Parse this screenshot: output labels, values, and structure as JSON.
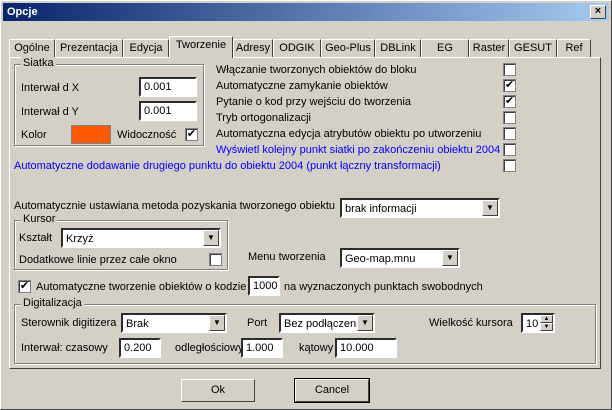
{
  "window": {
    "title": "Opcje",
    "close_glyph": "×"
  },
  "tabs": [
    "Ogólne",
    "Prezentacja",
    "Edycja",
    "Tworzenie",
    "Adresy",
    "ODGIK",
    "Geo-Plus",
    "DBLink",
    "EG",
    "Raster",
    "GESUT",
    "Ref"
  ],
  "active_tab": "Tworzenie",
  "siatka": {
    "title": "Siatka",
    "interwal_x_label": "Interwał d X",
    "interwal_x_value": "0.001",
    "interwal_y_label": "Interwał d Y",
    "interwal_y_value": "0.001",
    "kolor_label": "Kolor",
    "kolor_color": "#ff5a00",
    "widocznosc_label": "Widoczność",
    "widocznosc_checked": "✔"
  },
  "options": [
    {
      "label": "Włączanie tworzonych obiektów do bloku",
      "checked": "",
      "color": "#000000"
    },
    {
      "label": "Automatyczne zamykanie obiektów",
      "checked": "✔",
      "color": "#000000"
    },
    {
      "label": "Pytanie o kod przy wejściu do tworzenia",
      "checked": "✔",
      "color": "#000000"
    },
    {
      "label": "Tryb ortogonalizacji",
      "checked": "",
      "color": "#000000"
    },
    {
      "label": "Automatyczna edycja atrybutów obiektu po utworzeniu",
      "checked": "",
      "color": "#000000"
    },
    {
      "label": "Wyświetl kolejny punkt siatki po zakończeniu obiektu 2004",
      "checked": "",
      "color": "#0000ff"
    },
    {
      "label": "Automatyczne dodawanie drugiego punktu do obiektu 2004 (punkt łączny transformacji)",
      "checked": "",
      "color": "#0000ff"
    }
  ],
  "method": {
    "label": "Automatycznie ustawiana metoda pozyskania tworzonego obiektu",
    "value": "brak informacji"
  },
  "kursor": {
    "title": "Kursor",
    "ksztalt_label": "Kształt",
    "ksztalt_value": "Krzyż",
    "lines_label": "Dodatkowe linie przez całe okno",
    "lines_checked": ""
  },
  "menu": {
    "label": "Menu tworzenia",
    "value": "Geo-map.mnu"
  },
  "auto_create": {
    "checked": "✔",
    "label_before": "Automatyczne tworzenie obiektów o kodzie",
    "code": "1000",
    "label_after": "na wyznaczonych punktach swobodnych"
  },
  "digitalizacja": {
    "title": "Digitalizacja",
    "sterownik_label": "Sterownik digitizera",
    "sterownik_value": "Brak",
    "port_label": "Port",
    "port_value": "Bez podłączeni",
    "cursor_size_label": "Wielkość kursora",
    "cursor_size_value": "10",
    "interwal_label": "Interwał: czasowy",
    "czasowy_value": "0.200",
    "odleglosciowy_label": "odległościowy",
    "odleglosciowy_value": "1.000",
    "katowy_label": "kątowy",
    "katowy_value": "10.000"
  },
  "buttons": {
    "ok": "Ok",
    "cancel": "Cancel"
  }
}
